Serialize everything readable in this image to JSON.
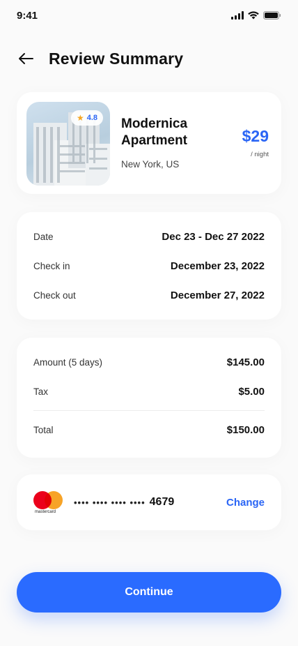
{
  "status": {
    "time": "9:41"
  },
  "header": {
    "title": "Review Summary"
  },
  "property": {
    "name": "Modernica Apartment",
    "location": "New York, US",
    "rating": "4.8",
    "price": "$29",
    "unit": "/ night"
  },
  "dates": [
    {
      "label": "Date",
      "value": "Dec 23 - Dec 27 2022"
    },
    {
      "label": "Check in",
      "value": "December 23, 2022"
    },
    {
      "label": "Check out",
      "value": "December 27, 2022"
    }
  ],
  "amounts": [
    {
      "label": "Amount (5 days)",
      "value": "$145.00"
    },
    {
      "label": "Tax",
      "value": "$5.00"
    }
  ],
  "total": {
    "label": "Total",
    "value": "$150.00"
  },
  "payment": {
    "brand": "mastercard",
    "masked": "•••• •••• •••• ••••",
    "last4": "4679",
    "change_label": "Change"
  },
  "continue_label": "Continue",
  "colors": {
    "accent": "#2a6bff",
    "text": "#111111"
  }
}
